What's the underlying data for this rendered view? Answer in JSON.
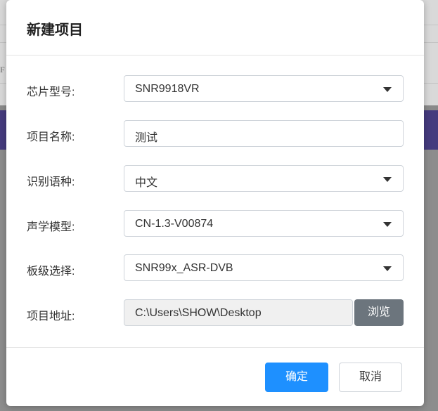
{
  "background": {
    "fragment": "F"
  },
  "dialog": {
    "title": "新建项目",
    "fields": [
      {
        "label": "芯片型号:",
        "value": "SNR9918VR",
        "type": "select"
      },
      {
        "label": "项目名称:",
        "value": "测试",
        "type": "text"
      },
      {
        "label": "识别语种:",
        "value": "中文",
        "type": "select"
      },
      {
        "label": "声学模型:",
        "value": "CN-1.3-V00874",
        "type": "select"
      },
      {
        "label": "板级选择:",
        "value": "SNR99x_ASR-DVB",
        "type": "select"
      },
      {
        "label": "项目地址:",
        "value": "C:\\Users\\SHOW\\Desktop",
        "type": "readonly"
      }
    ],
    "browse_label": "浏览",
    "confirm_label": "确定",
    "cancel_label": "取消"
  },
  "colors": {
    "primary": "#1e90ff",
    "secondary": "#6c757d",
    "header_band": "#453b7e"
  },
  "icons": {
    "select_caret": "caret-down-icon"
  }
}
